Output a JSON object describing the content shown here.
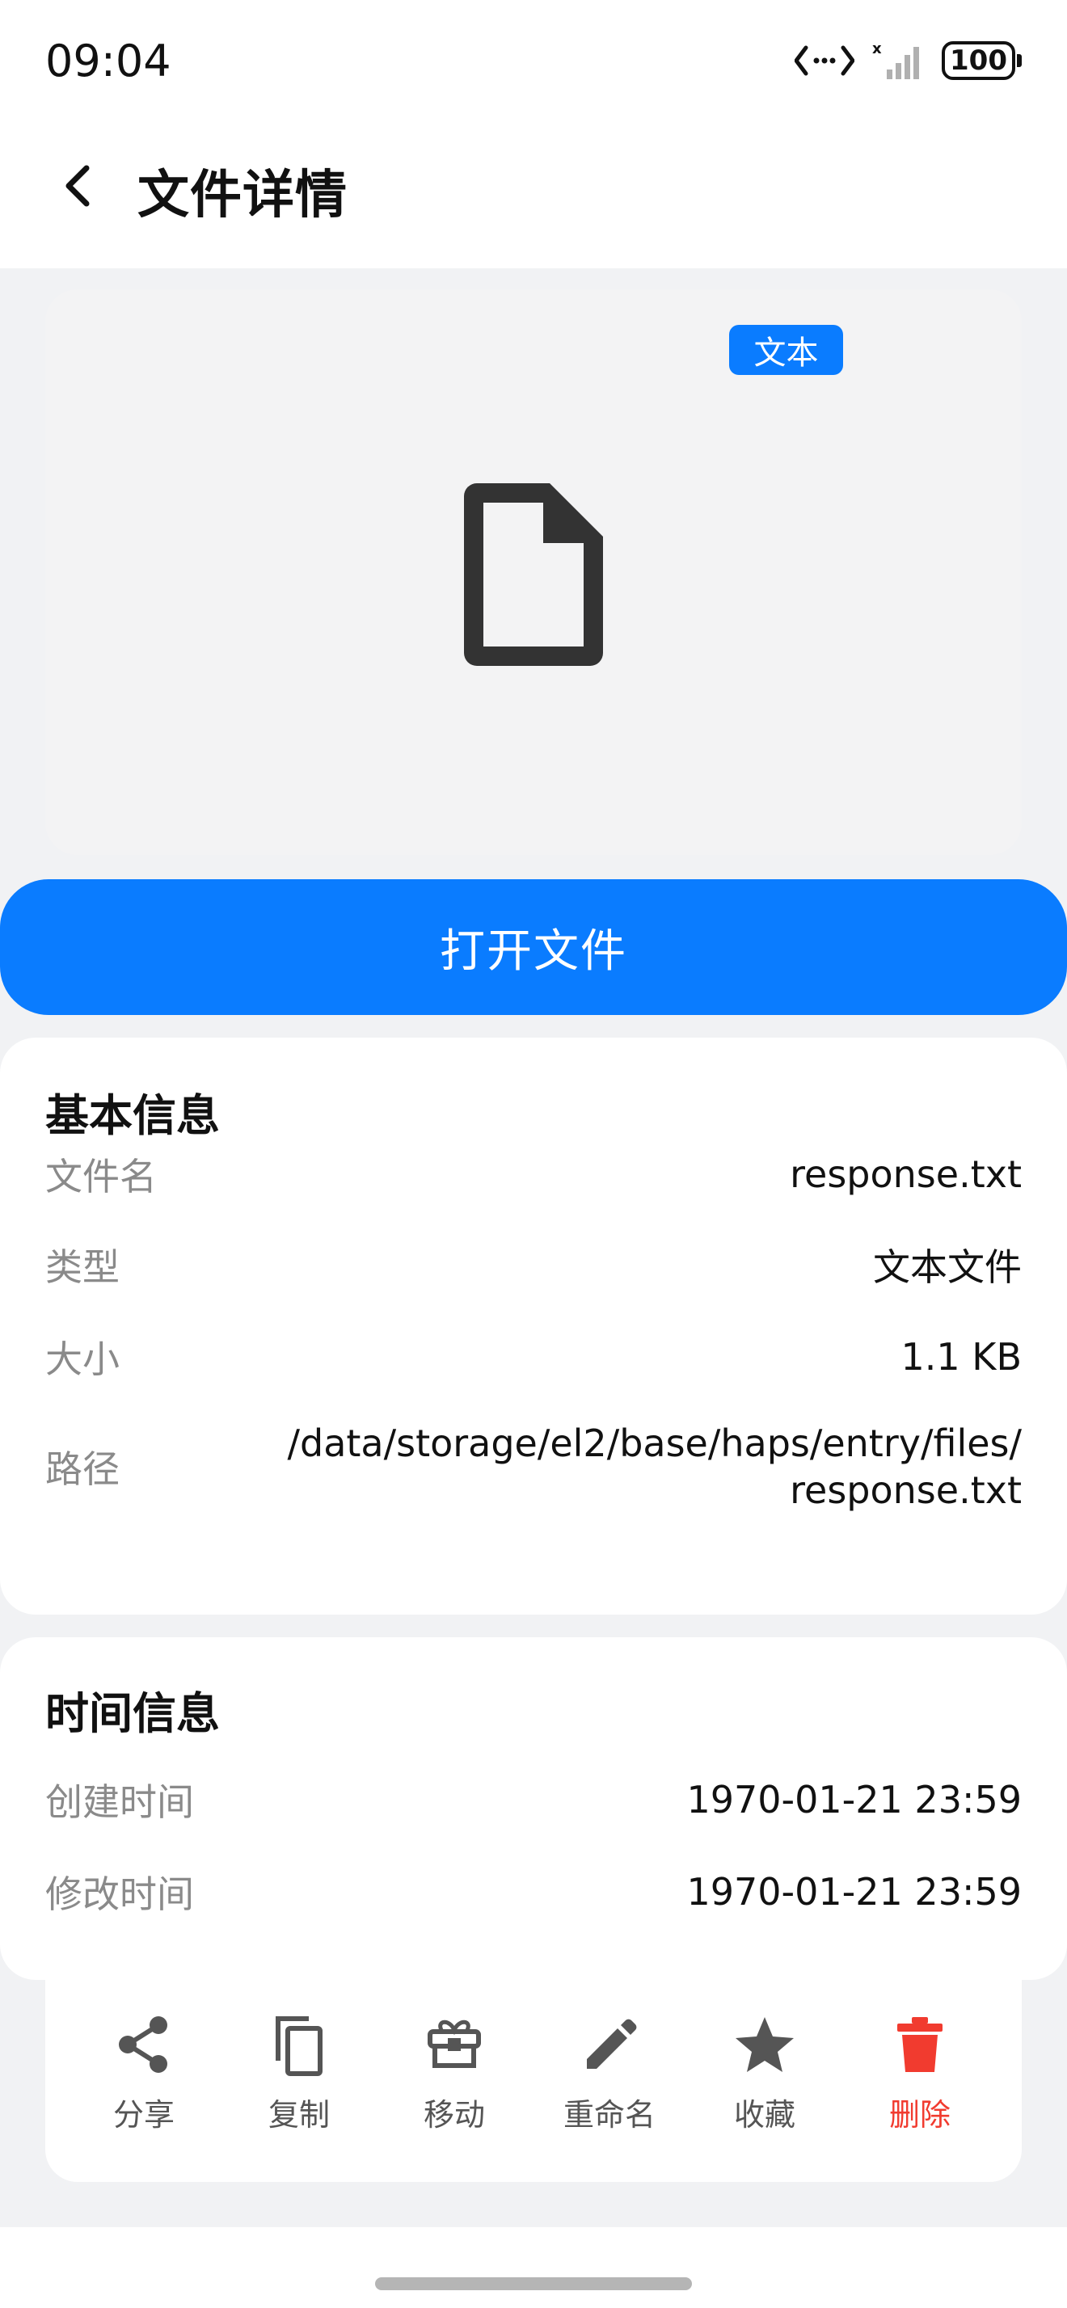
{
  "status_bar": {
    "time": "09:04",
    "battery": "100"
  },
  "header": {
    "title": "文件详情"
  },
  "preview": {
    "badge": "文本",
    "icon": "document-icon"
  },
  "open_button": {
    "label": "打开文件"
  },
  "basic_info": {
    "title": "基本信息",
    "rows": [
      {
        "label": "文件名",
        "value": "response.txt"
      },
      {
        "label": "类型",
        "value": "文本文件"
      },
      {
        "label": "大小",
        "value": "1.1 KB"
      },
      {
        "label": "路径",
        "value_line1": "/data/storage/el2/base/haps/entry/files/",
        "value_line2": "response.txt"
      }
    ]
  },
  "time_info": {
    "title": "时间信息",
    "rows": [
      {
        "label": "创建时间",
        "value": "1970-01-21 23:59"
      },
      {
        "label": "修改时间",
        "value": "1970-01-21 23:59"
      }
    ]
  },
  "toolbar": {
    "items": [
      {
        "label": "分享",
        "icon": "share-icon"
      },
      {
        "label": "复制",
        "icon": "copy-icon"
      },
      {
        "label": "移动",
        "icon": "move-icon"
      },
      {
        "label": "重命名",
        "icon": "edit-icon"
      },
      {
        "label": "收藏",
        "icon": "star-icon"
      },
      {
        "label": "删除",
        "icon": "trash-icon",
        "color": "#f13b2f"
      }
    ]
  },
  "colors": {
    "accent": "#0a7cff",
    "danger": "#f13b2f",
    "background": "#f1f2f4"
  }
}
